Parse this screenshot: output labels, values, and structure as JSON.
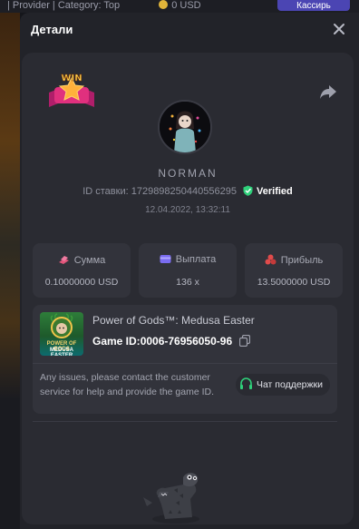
{
  "background": {
    "top_text": "| Provider | Category: Top",
    "balance": "0 USD",
    "button_label": "Кассирь"
  },
  "modal": {
    "title": "Детали",
    "close_icon": "close-icon"
  },
  "bet": {
    "badge_text": "WIN",
    "username": "NORMAN",
    "bet_id_label": "ID ставки:",
    "bet_id": "1729898250440556295",
    "verified_label": "Verified",
    "date": "12.04.2022, 13:32:11"
  },
  "stats": [
    {
      "label": "Сумма",
      "value": "0.10000000 USD",
      "icon": "coins-icon",
      "color": "#e2557a"
    },
    {
      "label": "Выплата",
      "value": "136 x",
      "icon": "wallet-icon",
      "color": "#7a6cf0"
    },
    {
      "label": "Прибыль",
      "value": "13.5000000 USD",
      "icon": "profit-icon",
      "color": "#e04b4b"
    }
  ],
  "game": {
    "title": "Power of Gods™: Medusa Easter",
    "id_label": "Game ID:",
    "id_value": "0006-76956050-96",
    "thumb_text_1": "POWER OF GODS",
    "thumb_text_2": "MEDUSA EASTER",
    "support_text": "Any issues, please contact the customer service for help and provide the game ID.",
    "support_button": "Чат поддержки"
  },
  "colors": {
    "modal_bg": "#222329",
    "card_bg": "#2a2b32",
    "tile_bg": "#32333b",
    "verified": "#2fd07a"
  }
}
